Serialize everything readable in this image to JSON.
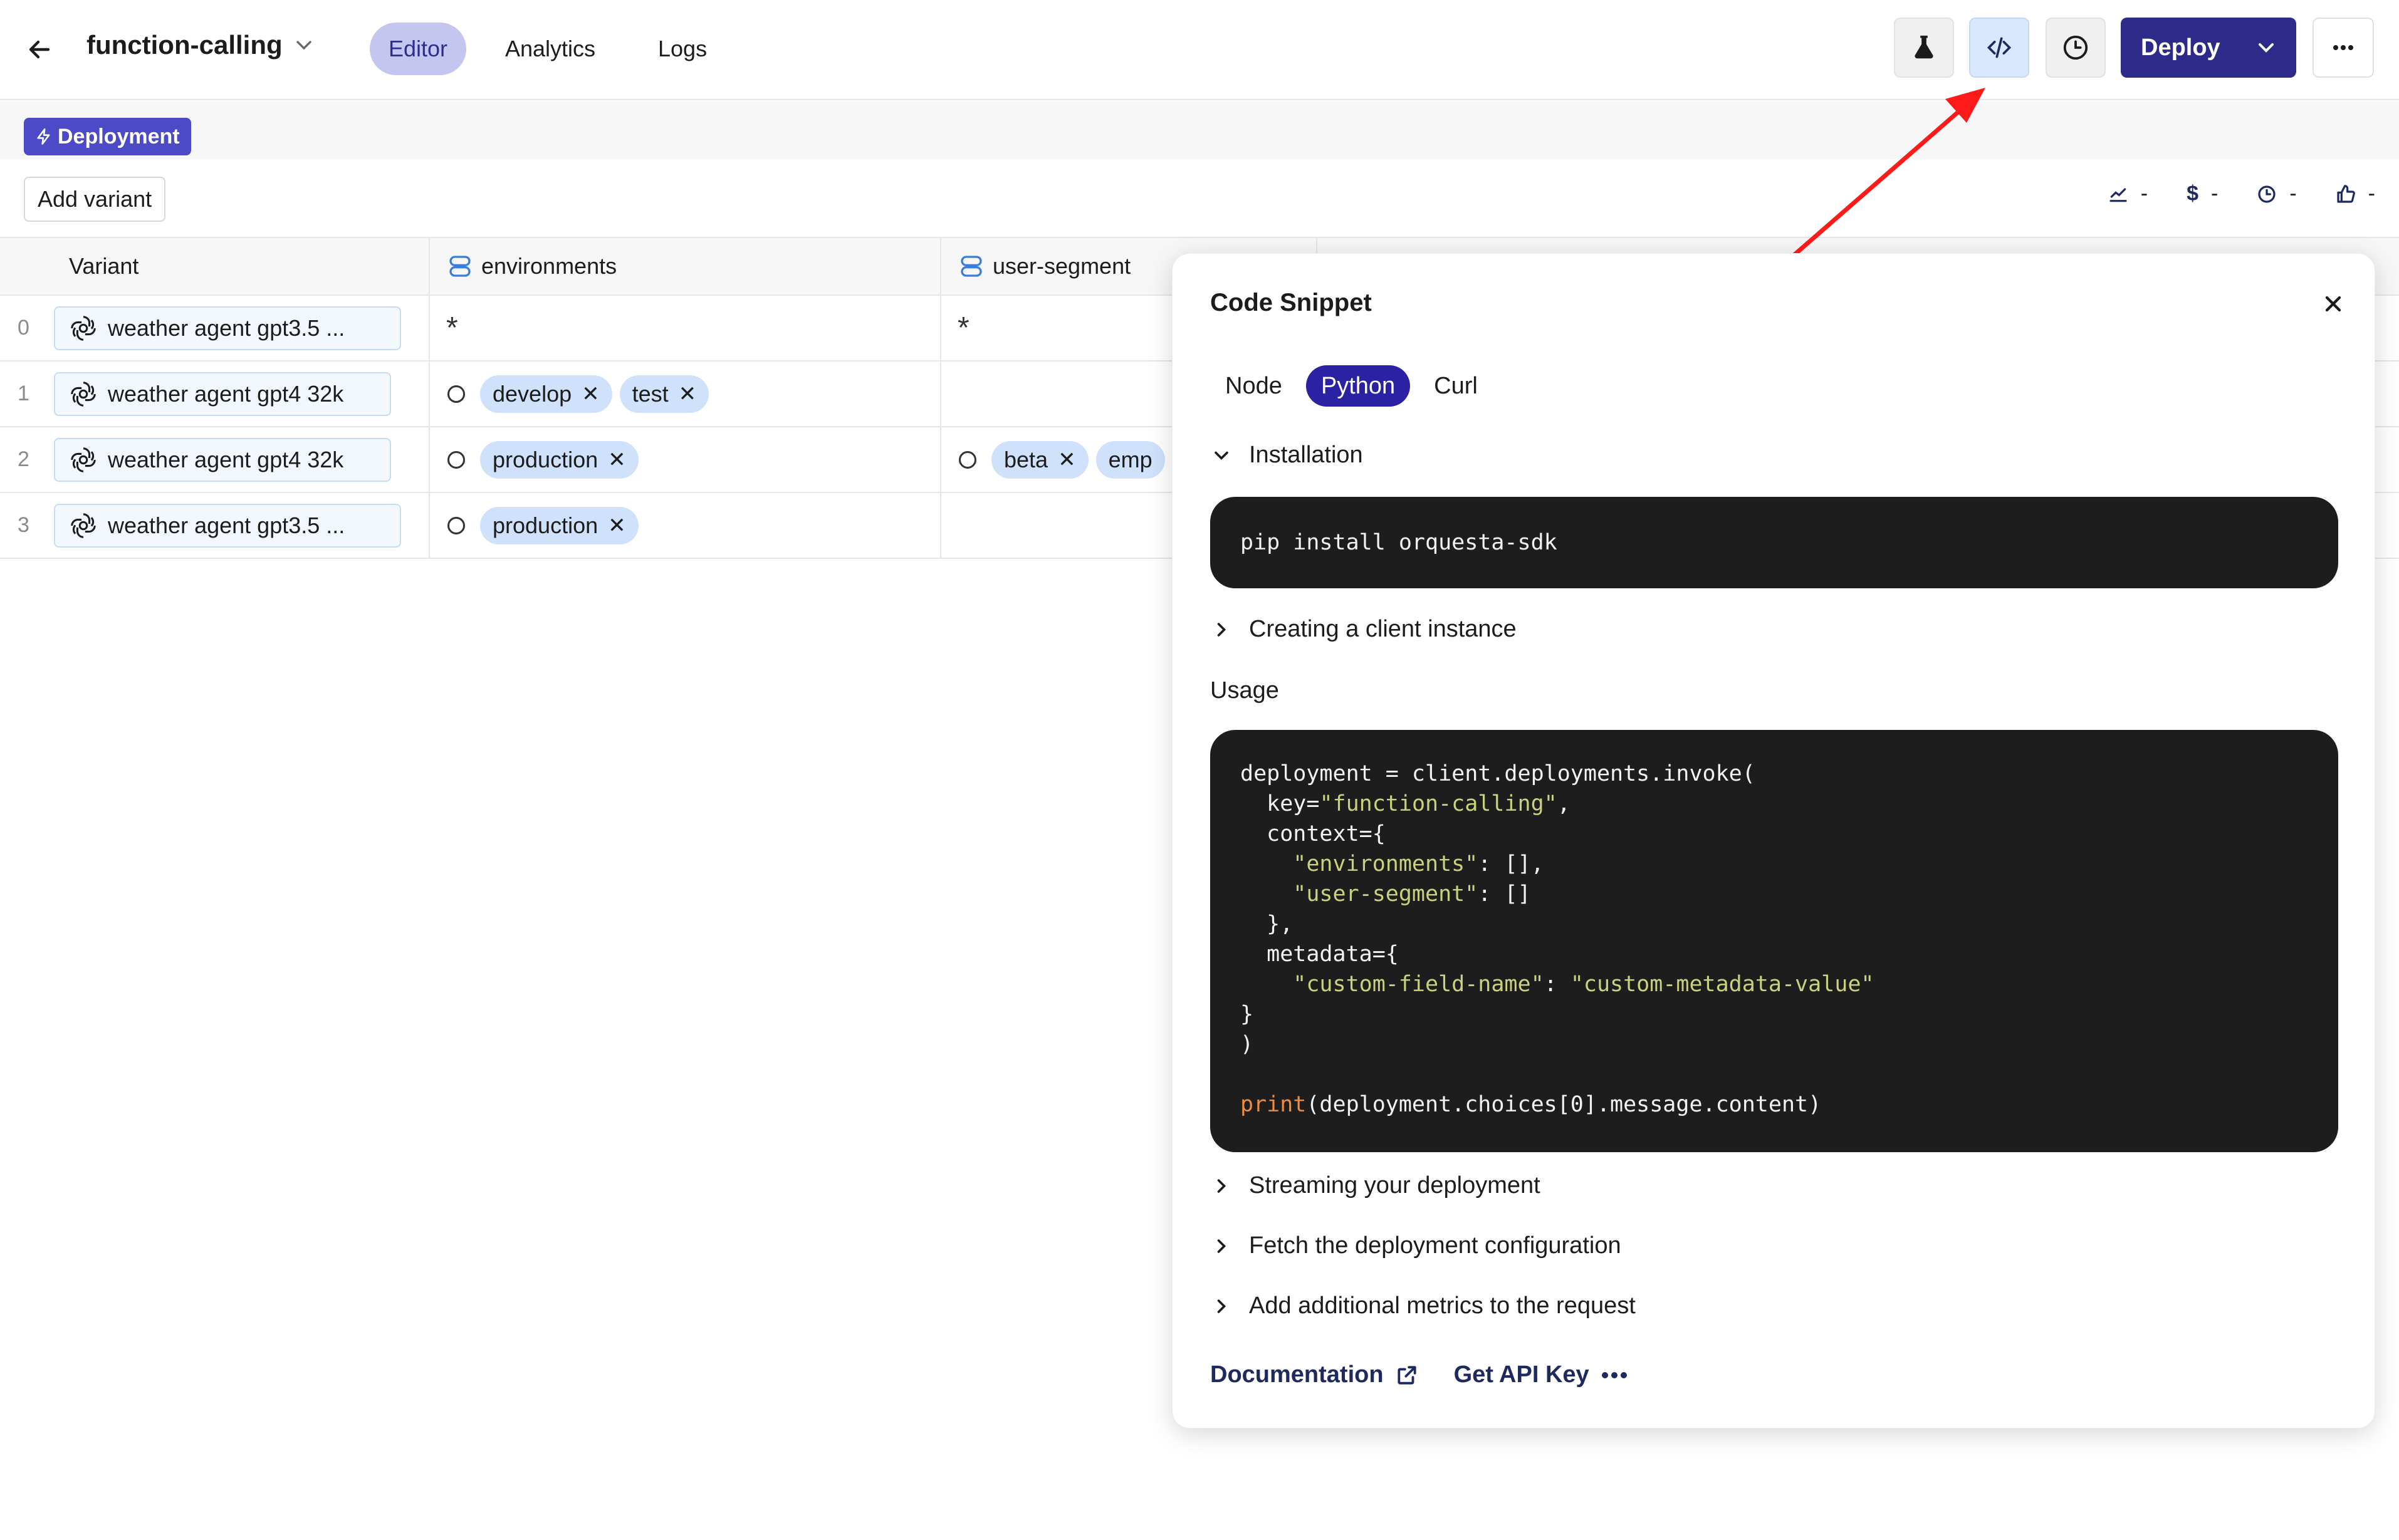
{
  "header": {
    "title": "function-calling",
    "tabs": [
      {
        "label": "Editor",
        "active": true
      },
      {
        "label": "Analytics",
        "active": false
      },
      {
        "label": "Logs",
        "active": false
      }
    ],
    "deploy_label": "Deploy"
  },
  "subbar": {
    "badge": "Deployment",
    "add_variant": "Add variant",
    "metrics": [
      {
        "icon": "chart-icon",
        "value": "-"
      },
      {
        "icon": "dollar-icon",
        "value": "-"
      },
      {
        "icon": "clock-icon",
        "value": "-"
      },
      {
        "icon": "thumbs-up-icon",
        "value": "-"
      }
    ]
  },
  "table": {
    "columns": [
      "Variant",
      "environments",
      "user-segment"
    ],
    "rows": [
      {
        "index": "0",
        "variant": "weather agent gpt3.5 ...",
        "env": "*",
        "env_chips": [],
        "seg": "*",
        "seg_chips": []
      },
      {
        "index": "1",
        "variant": "weather agent gpt4 32k",
        "env": "",
        "env_chips": [
          "develop",
          "test"
        ],
        "seg": "",
        "seg_chips": []
      },
      {
        "index": "2",
        "variant": "weather agent gpt4 32k",
        "env": "",
        "env_chips": [
          "production"
        ],
        "seg": "",
        "seg_chips": [
          "beta",
          "emp"
        ]
      },
      {
        "index": "3",
        "variant": "weather agent gpt3.5 ...",
        "env": "",
        "env_chips": [
          "production"
        ],
        "seg": "",
        "seg_chips": []
      }
    ]
  },
  "snippet": {
    "title": "Code Snippet",
    "langs": [
      "Node",
      "Python",
      "Curl"
    ],
    "active_lang": "Python",
    "installation": "Installation",
    "install_cmd": "pip install orquesta-sdk",
    "client": "Creating a client instance",
    "usage": "Usage",
    "code": {
      "l1": "deployment = client.deployments.invoke(",
      "l2a": "  key=",
      "l2s": "\"function-calling\"",
      "l2b": ",",
      "l3": "  context={",
      "l4s": "    \"environments\"",
      "l4b": ": [],",
      "l5s": "    \"user-segment\"",
      "l5b": ": []",
      "l6": "  },",
      "l7": "  metadata={",
      "l8s": "    \"custom-field-name\"",
      "l8b": ": ",
      "l8s2": "\"custom-metadata-value\"",
      "l9": "}",
      "l10": ")",
      "l12k": "print",
      "l12b": "(deployment.choices[0].message.content)"
    },
    "streaming": "Streaming your deployment",
    "fetch": "Fetch the deployment configuration",
    "metrics": "Add additional metrics to the request",
    "doc_link": "Documentation",
    "api_key": "Get API Key"
  },
  "colors": {
    "accent": "#2d2a8a",
    "badge": "#4d4ac8",
    "chip": "#cfe1fb",
    "arrow": "#ff1a1a"
  }
}
